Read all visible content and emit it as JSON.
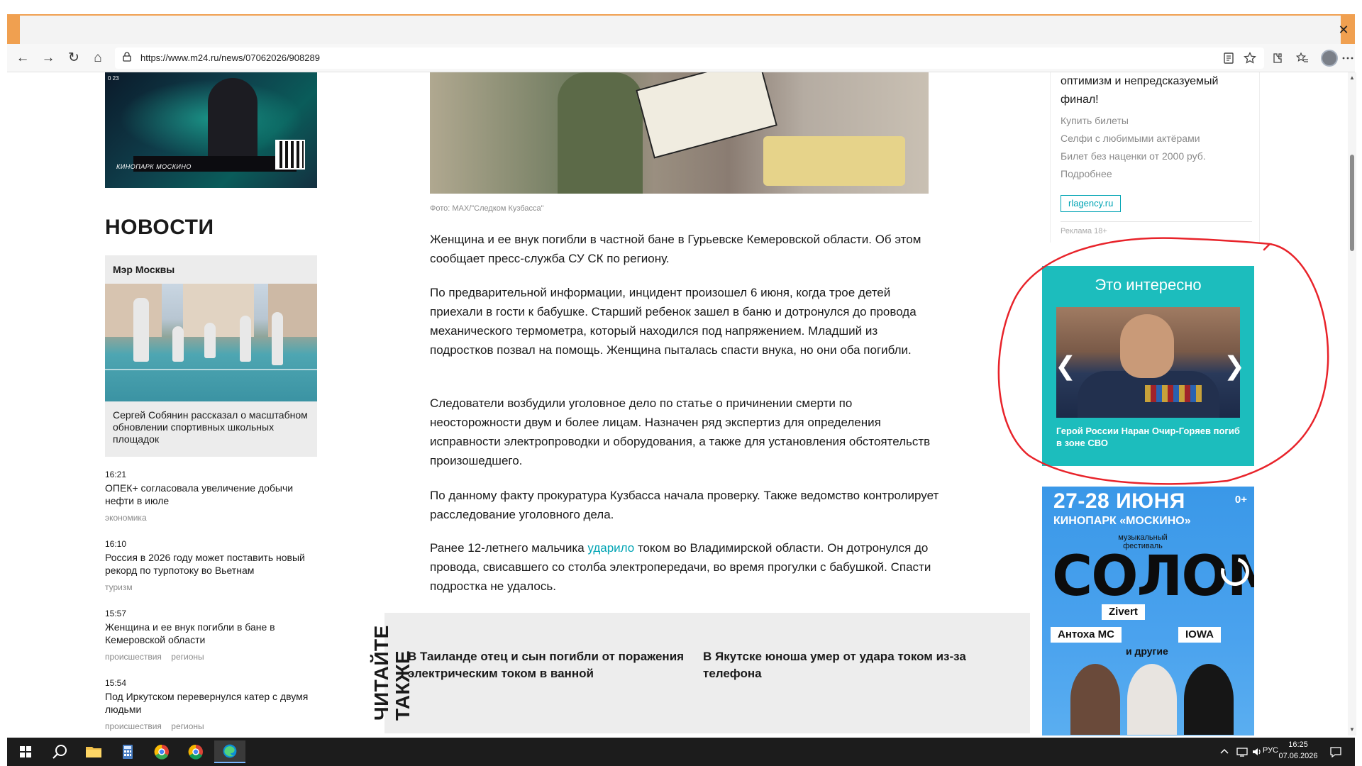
{
  "browser": {
    "url": "https://www.m24.ru/news/07062026/908289",
    "close_glyph": "✕",
    "nav": {
      "back_icon": "←",
      "forward_icon": "→",
      "reload_icon": "↻",
      "home_icon": "⌂"
    },
    "address_icons": [
      "reader-view-icon",
      "favorite-star-icon"
    ],
    "toolbar_icons": [
      "extensions-icon",
      "favorites-icon",
      "profile-avatar",
      "more-menu-icon"
    ]
  },
  "left": {
    "promo_badge": "0 23",
    "promo_caption": "КИНОПАРК МОСКИНО",
    "news_heading": "НОВОСТИ",
    "mayor_card": {
      "label": "Мэр Москвы",
      "caption": "Сергей Собянин рассказал о масштабном обновлении спортивных школьных площадок"
    },
    "news": [
      {
        "time": "16:21",
        "title": "ОПЕК+ согласовала увеличение добычи нефти в июле",
        "tags": [
          "экономика"
        ]
      },
      {
        "time": "16:10",
        "title": "Россия в 2026 году может поставить новый рекорд по турпотоку во Вьетнам",
        "tags": [
          "туризм"
        ]
      },
      {
        "time": "15:57",
        "title": "Женщина и ее внук погибли в бане в Кемеровской области",
        "tags": [
          "происшествия",
          "регионы"
        ]
      },
      {
        "time": "15:54",
        "title": "Под Иркутском перевернулся катер с двумя людьми",
        "tags": [
          "происшествия",
          "регионы"
        ]
      }
    ]
  },
  "article": {
    "photo_credit": "Фото: MAX/\"Следком Кузбасса\"",
    "paragraphs": [
      "Женщина и ее внук погибли в частной бане в Гурьевске Кемеровской области. Об этом сообщает пресс-служба СУ СК по региону.",
      "По предварительной информации, инцидент произошел 6 июня, когда трое детей приехали в гости к бабушке. Старший ребенок зашел в баню и дотронулся до провода механического термометра, который находился под напряжением. Младший из подростков позвал на помощь. Женщина пыталась спасти внука, но они оба погибли.",
      "Следователи возбудили уголовное дело по статье о причинении смерти по неосторожности двум и более лицам. Назначен ряд экспертиз для определения исправности электропроводки и оборудования, а также для установления обстоятельств произошедшего.",
      "По данному факту прокуратура Кузбасса начала проверку. Также ведомство контролирует расследование уголовного дела."
    ],
    "last_paragraph": {
      "before": "Ранее 12-летнего мальчика ",
      "link": "ударило",
      "after": " током во Владимирской области. Он дотронулся до провода, свисавшего со столба электропередачи, во время прогулки с бабушкой. Спасти подростка не удалось."
    },
    "read_also": {
      "label_line1": "ЧИТАЙТЕ",
      "label_line2": "ТАКЖЕ",
      "items": [
        "В Таиланде отец и сын погибли от поражения электрическим током в ванной",
        "В Якутске юноша умер от удара током из-за телефона"
      ]
    }
  },
  "right": {
    "ad_card": {
      "title": "оптимизм и непредсказуемый финал!",
      "links": [
        "Купить билеты",
        "Селфи с любимыми актёрами",
        "Билет без наценки от 2000 руб.",
        "Подробнее"
      ],
      "agency": "rlagency.ru",
      "ad_label": "Реклама 18+"
    },
    "interest": {
      "title": "Это интересно",
      "prev_icon": "❮",
      "next_icon": "❯",
      "caption": "Герой России Наран Очир-Горяев погиб в зоне СВО"
    },
    "festival": {
      "date": "27-28 ИЮНЯ",
      "age": "0+",
      "venue": "КИНОПАРК «МОСКИНО»",
      "kind": "музыкальный фестиваль",
      "name": "СОЛОМА",
      "headliner": "Zivert",
      "artists": [
        "Антоха МС",
        "IOWA"
      ],
      "others": "и другие"
    }
  },
  "annotation": {
    "color": "#e8232a"
  },
  "taskbar": {
    "lang": "РУС",
    "time": "16:25",
    "date": "07.06.2026",
    "apps": [
      "start-icon",
      "search-icon",
      "file-explorer-icon",
      "calculator-icon",
      "chrome-color-icon",
      "chrome-icon",
      "edge-icon"
    ]
  },
  "colors": {
    "accent": "#00a4b4",
    "interest_bg": "#1cbdbd",
    "festival_bg": "#3a98e8",
    "chrome_accent": "#f0a050"
  }
}
